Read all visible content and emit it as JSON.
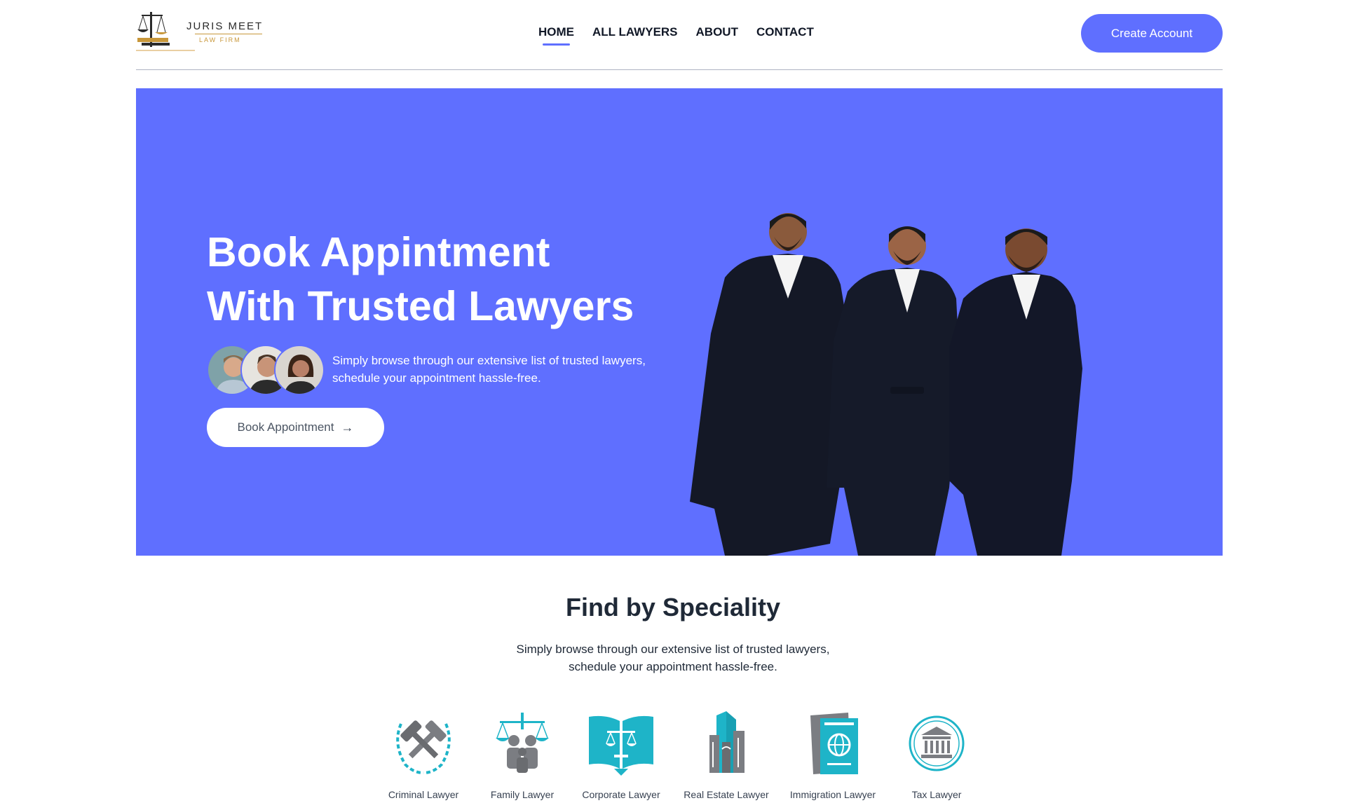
{
  "brand": {
    "name": "JURIS MEET",
    "tagline": "LAW FIRM"
  },
  "nav": {
    "items": [
      {
        "label": "HOME",
        "active": true
      },
      {
        "label": "ALL LAWYERS",
        "active": false
      },
      {
        "label": "ABOUT",
        "active": false
      },
      {
        "label": "CONTACT",
        "active": false
      }
    ]
  },
  "header": {
    "create_account_label": "Create Account"
  },
  "hero": {
    "title_line1": "Book Appintment",
    "title_line2": "With Trusted Lawyers",
    "desc_line1": "Simply browse through our extensive list of trusted lawyers,",
    "desc_line2": "schedule your appointment hassle-free.",
    "book_button_label": "Book Appointment",
    "book_button_icon": "arrow-right-icon"
  },
  "speciality": {
    "title": "Find by Speciality",
    "desc_line1": "Simply browse through our extensive list of trusted lawyers,",
    "desc_line2": "schedule your appointment hassle-free.",
    "items": [
      {
        "label": "Criminal Lawyer",
        "icon": "gavels-laurel-icon"
      },
      {
        "label": "Family Lawyer",
        "icon": "family-scales-icon"
      },
      {
        "label": "Corporate Lawyer",
        "icon": "book-scales-icon"
      },
      {
        "label": "Real Estate Lawyer",
        "icon": "buildings-icon"
      },
      {
        "label": "Immigration Lawyer",
        "icon": "passport-icon"
      },
      {
        "label": "Tax Lawyer",
        "icon": "government-building-icon"
      }
    ]
  },
  "colors": {
    "primary": "#5f6fff",
    "accent_gold": "#c8973a",
    "icon_teal": "#1eb4c8",
    "icon_gray": "#7b7d82"
  }
}
